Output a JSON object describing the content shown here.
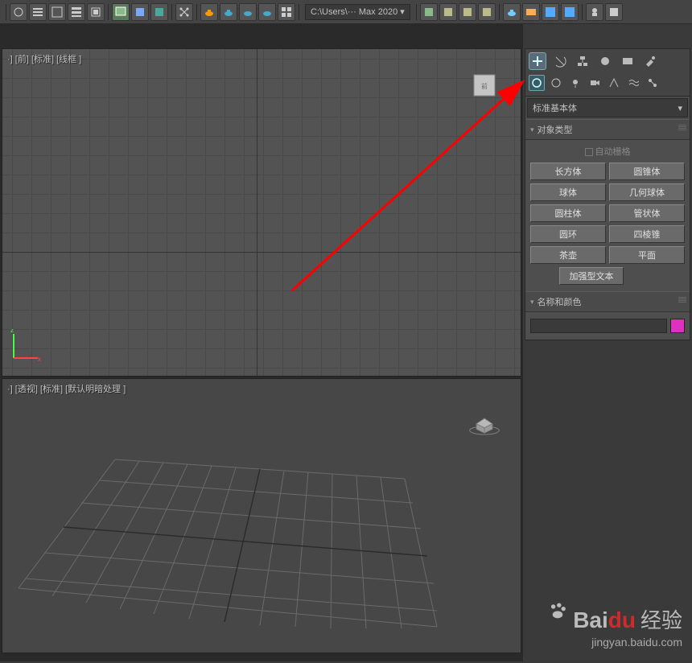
{
  "toolbar": {
    "path": "C:\\Users\\··· Max 2020  ▾"
  },
  "viewport_top": {
    "label": "·] [前] [标准] [线框 ]"
  },
  "viewport_bottom": {
    "label": "·] [透视] [标准] [默认明暗处理 ]"
  },
  "panel": {
    "dropdown": "标准基本体",
    "section_obj": "对象类型",
    "auto_grid": "自动栅格",
    "buttons": {
      "box": "长方体",
      "cone": "圆锥体",
      "sphere": "球体",
      "geosphere": "几何球体",
      "cylinder": "圆柱体",
      "tube": "管状体",
      "torus": "圆环",
      "pyramid": "四棱锥",
      "teapot": "茶壶",
      "plane": "平面",
      "textplus": "加强型文本"
    },
    "section_name": "名称和颜色",
    "color": "#e030c0"
  },
  "watermark": {
    "brand_a": "Bai",
    "brand_b": "du",
    "brand_c": "经验",
    "sub": "jingyan.baidu.com"
  }
}
